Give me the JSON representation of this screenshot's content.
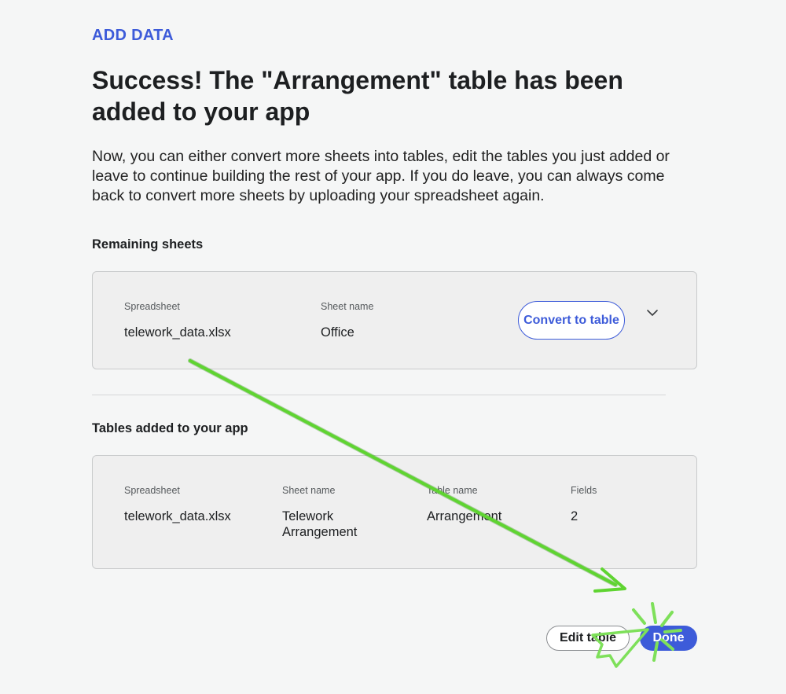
{
  "header": {
    "eyebrow": "ADD DATA",
    "title": "Success! The \"Arrangement\" table has been added to your app",
    "intro": "Now, you can either convert more sheets into tables, edit the tables you just added or leave to continue building the rest of your app. If you do leave, you can always come back to convert more sheets by uploading your spreadsheet again."
  },
  "remaining": {
    "heading": "Remaining sheets",
    "spreadsheet_label": "Spreadsheet",
    "spreadsheet_value": "telework_data.xlsx",
    "sheet_label": "Sheet name",
    "sheet_value": "Office",
    "convert_label": "Convert to table",
    "expand_icon": "chevron-down-icon"
  },
  "added": {
    "heading": "Tables added to your app",
    "spreadsheet_label": "Spreadsheet",
    "spreadsheet_value": "telework_data.xlsx",
    "sheet_label": "Sheet name",
    "sheet_value": "Telework Arrangement",
    "table_label": "Table name",
    "table_value": "Arrangement",
    "fields_label": "Fields",
    "fields_value": "2"
  },
  "footer": {
    "edit_label": "Edit table",
    "done_label": "Done"
  },
  "colors": {
    "accent": "#3d5bd9",
    "background": "#f5f6f6",
    "card": "#efefef",
    "annotation": "#5fd431"
  }
}
